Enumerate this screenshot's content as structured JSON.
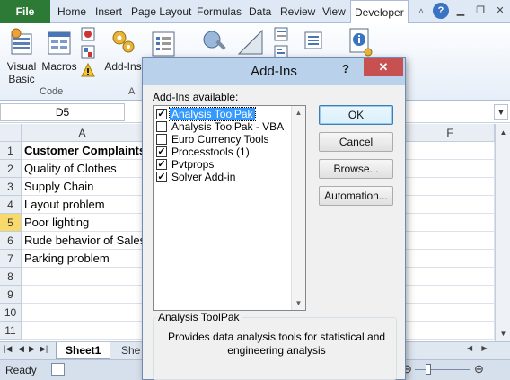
{
  "ribbon_tabs": {
    "file": "File",
    "items": [
      "Home",
      "Insert",
      "Page Layout",
      "Formulas",
      "Data",
      "Review",
      "View",
      "Developer"
    ],
    "active": "Developer"
  },
  "ribbon": {
    "visual_basic_l1": "Visual",
    "visual_basic_l2": "Basic",
    "macros": "Macros",
    "addins": "Add-Ins",
    "group_code": "Code",
    "group_addins": "A"
  },
  "formula_bar": {
    "name_box": "D5"
  },
  "grid": {
    "columns": [
      "A",
      "F"
    ],
    "rows": [
      "1",
      "2",
      "3",
      "4",
      "5",
      "6",
      "7",
      "8",
      "9",
      "10",
      "11"
    ],
    "selected_row": "5",
    "cells_a": [
      "Customer Complaints",
      "Quality of Clothes",
      "Supply Chain",
      "Layout problem",
      "Poor lighting",
      "Rude behavior of Sales",
      "Parking problem",
      "",
      "",
      "",
      ""
    ]
  },
  "sheets": {
    "sheet1": "Sheet1",
    "sheet2": "She"
  },
  "status": {
    "ready": "Ready"
  },
  "dialog": {
    "title": "Add-Ins",
    "help": "?",
    "available_label": "Add-Ins available:",
    "addins": [
      {
        "label": "Analysis ToolPak",
        "checked": true,
        "selected": true
      },
      {
        "label": "Analysis ToolPak - VBA",
        "checked": false,
        "selected": false
      },
      {
        "label": "Euro Currency Tools",
        "checked": false,
        "selected": false
      },
      {
        "label": "Processtools (1)",
        "checked": true,
        "selected": false
      },
      {
        "label": "Pvtprops",
        "checked": true,
        "selected": false
      },
      {
        "label": "Solver Add-in",
        "checked": true,
        "selected": false
      }
    ],
    "buttons": {
      "ok": "OK",
      "cancel": "Cancel",
      "browse": "Browse...",
      "automation": "Automation..."
    },
    "description_title": "Analysis ToolPak",
    "description": "Provides data analysis tools for statistical and engineering analysis"
  }
}
